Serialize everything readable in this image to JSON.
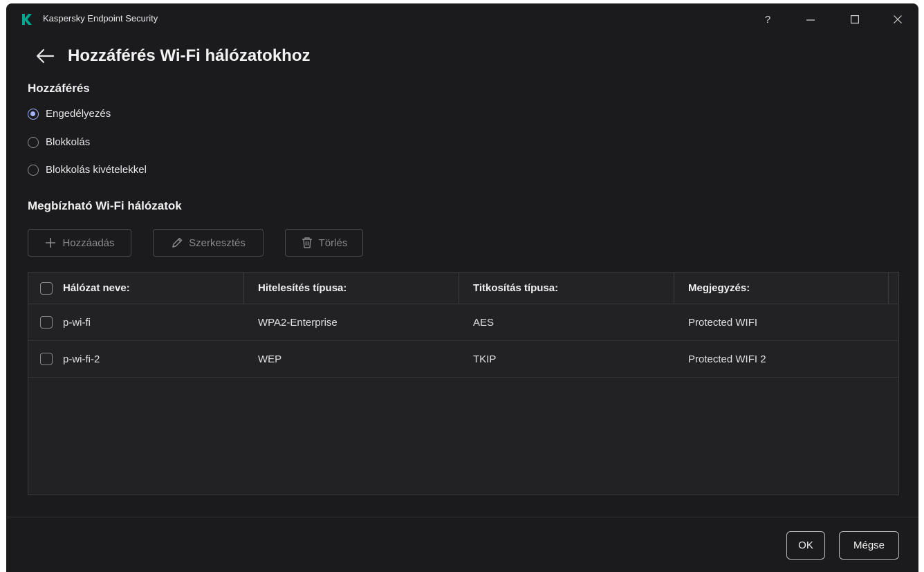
{
  "window": {
    "app_title": "Kaspersky Endpoint Security",
    "help_label": "?",
    "brand_color": "#00a88e"
  },
  "page": {
    "title": "Hozzáférés Wi-Fi hálózatokhoz"
  },
  "access": {
    "heading": "Hozzáférés",
    "options": [
      {
        "label": "Engedélyezés",
        "checked": true
      },
      {
        "label": "Blokkolás",
        "checked": false
      },
      {
        "label": "Blokkolás kivételekkel",
        "checked": false
      }
    ]
  },
  "trusted": {
    "heading": "Megbízható Wi-Fi hálózatok"
  },
  "toolbar": {
    "add_label": "Hozzáadás",
    "edit_label": "Szerkesztés",
    "delete_label": "Törlés"
  },
  "table": {
    "columns": [
      "Hálózat neve:",
      "Hitelesítés típusa:",
      "Titkosítás típusa:",
      "Megjegyzés:"
    ],
    "rows": [
      [
        "p-wi-fi",
        "WPA2-Enterprise",
        "AES",
        "Protected WIFI"
      ],
      [
        "p-wi-fi-2",
        "WEP",
        "TKIP",
        "Protected WIFI 2"
      ]
    ]
  },
  "footer": {
    "ok_label": "OK",
    "cancel_label": "Mégse"
  }
}
